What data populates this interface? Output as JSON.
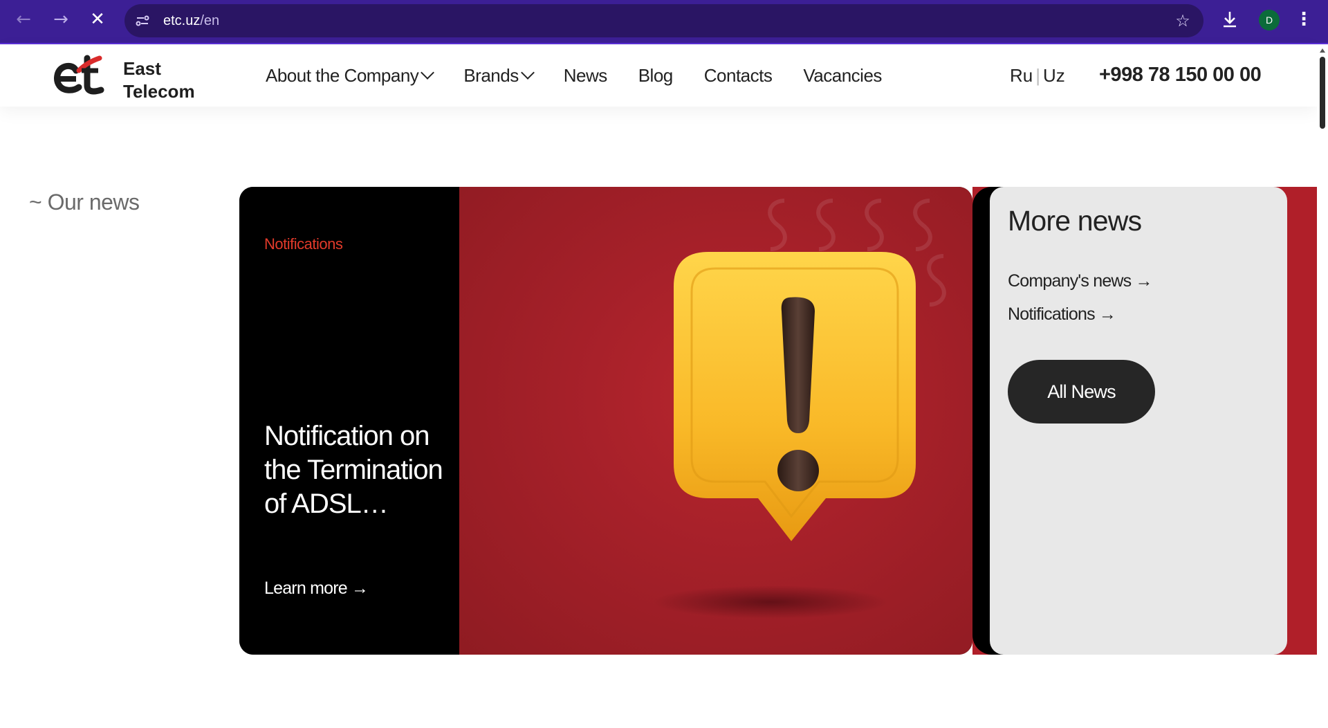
{
  "browser": {
    "url_host": "etc.uz",
    "url_path": "/en",
    "avatar_letter": "D"
  },
  "header": {
    "logo_line1": "East",
    "logo_line2": "Telecom",
    "menu": [
      {
        "label": "About the Company",
        "has_dropdown": true
      },
      {
        "label": "Brands",
        "has_dropdown": true
      },
      {
        "label": "News",
        "has_dropdown": false
      },
      {
        "label": "Blog",
        "has_dropdown": false
      },
      {
        "label": "Contacts",
        "has_dropdown": false
      },
      {
        "label": "Vacancies",
        "has_dropdown": false
      }
    ],
    "lang_ru": "Ru",
    "lang_sep": "|",
    "lang_uz": "Uz",
    "phone": "+998 78 150 00 00"
  },
  "section": {
    "label": "~ Our news"
  },
  "featured": {
    "tag": "Notifications",
    "title": "Notification on the Termination of ADSL…",
    "link": "Learn more →",
    "image_icon": "exclamation-bubble-icon"
  },
  "more_news": {
    "title": "More news",
    "links": [
      "Company's news →",
      "Notifications →"
    ],
    "button": "All News"
  },
  "colors": {
    "chrome_bg": "#3c1f95",
    "accent_red": "#e23a2a",
    "card_red": "#a52029",
    "button_dark": "#262626"
  }
}
